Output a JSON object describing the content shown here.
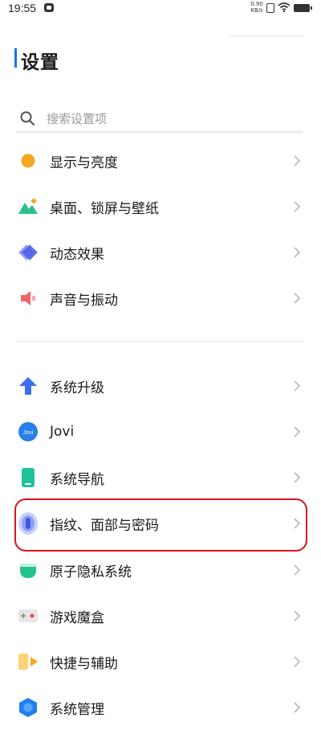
{
  "status_bar": {
    "time": "19:55",
    "net_speed_value": "0.90",
    "net_speed_unit": "KB/s"
  },
  "page": {
    "title": "设置"
  },
  "search": {
    "placeholder": "搜索设置项"
  },
  "items": [
    {
      "label": "显示与亮度",
      "icon": "display-brightness-icon"
    },
    {
      "label": "桌面、锁屏与壁纸",
      "icon": "wallpaper-icon"
    },
    {
      "label": "动态效果",
      "icon": "dynamic-effects-icon"
    },
    {
      "label": "声音与振动",
      "icon": "sound-vibration-icon"
    },
    {
      "label": "系统升级",
      "icon": "system-upgrade-icon"
    },
    {
      "label": "Jovi",
      "icon": "jovi-icon"
    },
    {
      "label": "系统导航",
      "icon": "system-navigation-icon"
    },
    {
      "label": "指纹、面部与密码",
      "icon": "fingerprint-face-password-icon"
    },
    {
      "label": "原子隐私系统",
      "icon": "atom-privacy-icon"
    },
    {
      "label": "游戏魔盒",
      "icon": "game-box-icon"
    },
    {
      "label": "快捷与辅助",
      "icon": "shortcuts-accessibility-icon"
    },
    {
      "label": "系统管理",
      "icon": "system-management-icon"
    }
  ],
  "jovi_icon_text": "Jovi",
  "colors": {
    "accent": "#1a73e8",
    "highlight": "#d9141e"
  }
}
